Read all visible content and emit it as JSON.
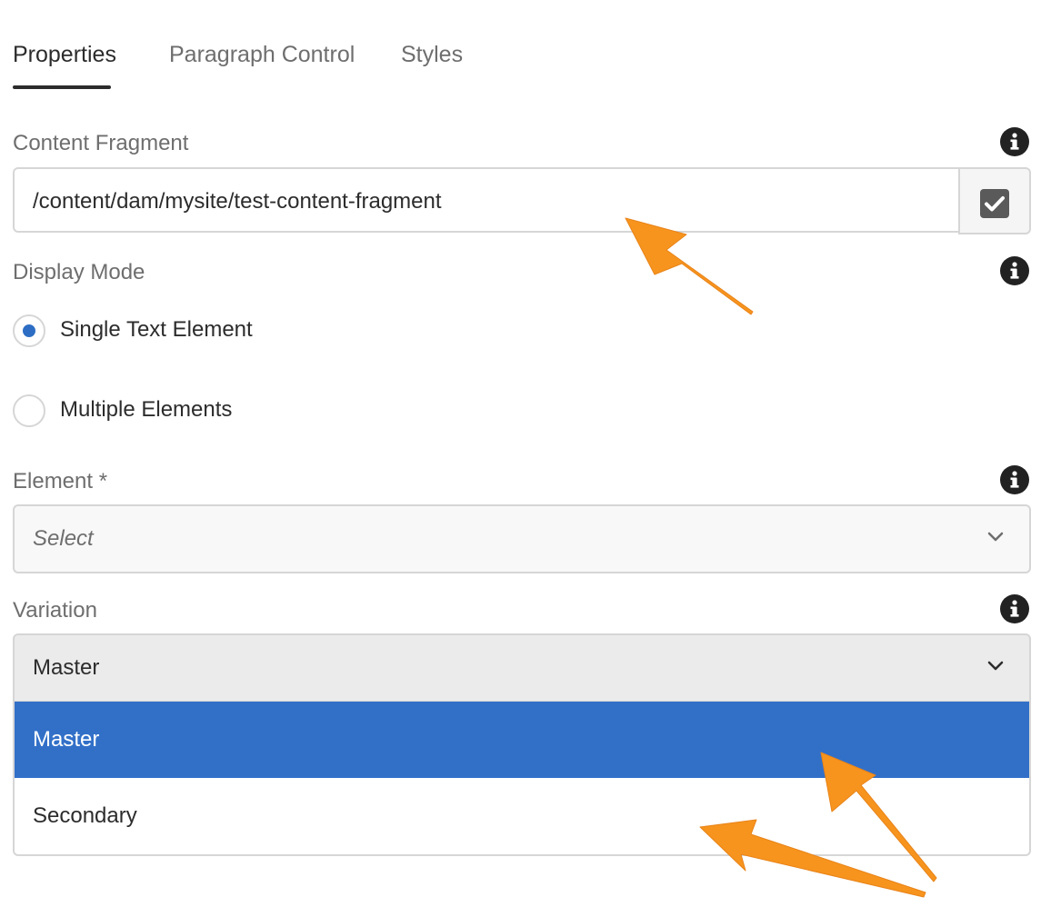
{
  "tabs": [
    {
      "label": "Properties",
      "active": true
    },
    {
      "label": "Paragraph Control",
      "active": false
    },
    {
      "label": "Styles",
      "active": false
    }
  ],
  "content_fragment": {
    "label": "Content Fragment",
    "value": "/content/dam/mysite/test-content-fragment",
    "picker_icon": "checkbox-check-icon"
  },
  "display_mode": {
    "label": "Display Mode",
    "options": [
      {
        "label": "Single Text Element",
        "checked": true
      },
      {
        "label": "Multiple Elements",
        "checked": false
      }
    ]
  },
  "element": {
    "label": "Element *",
    "placeholder": "Select"
  },
  "variation": {
    "label": "Variation",
    "value": "Master",
    "options": [
      {
        "label": "Master",
        "selected": true
      },
      {
        "label": "Secondary",
        "selected": false
      }
    ]
  },
  "colors": {
    "accent": "#3270c8",
    "annotation_arrow": "#f7941d"
  },
  "icons": {
    "info": "info-icon",
    "chevron": "chevron-down-icon"
  }
}
